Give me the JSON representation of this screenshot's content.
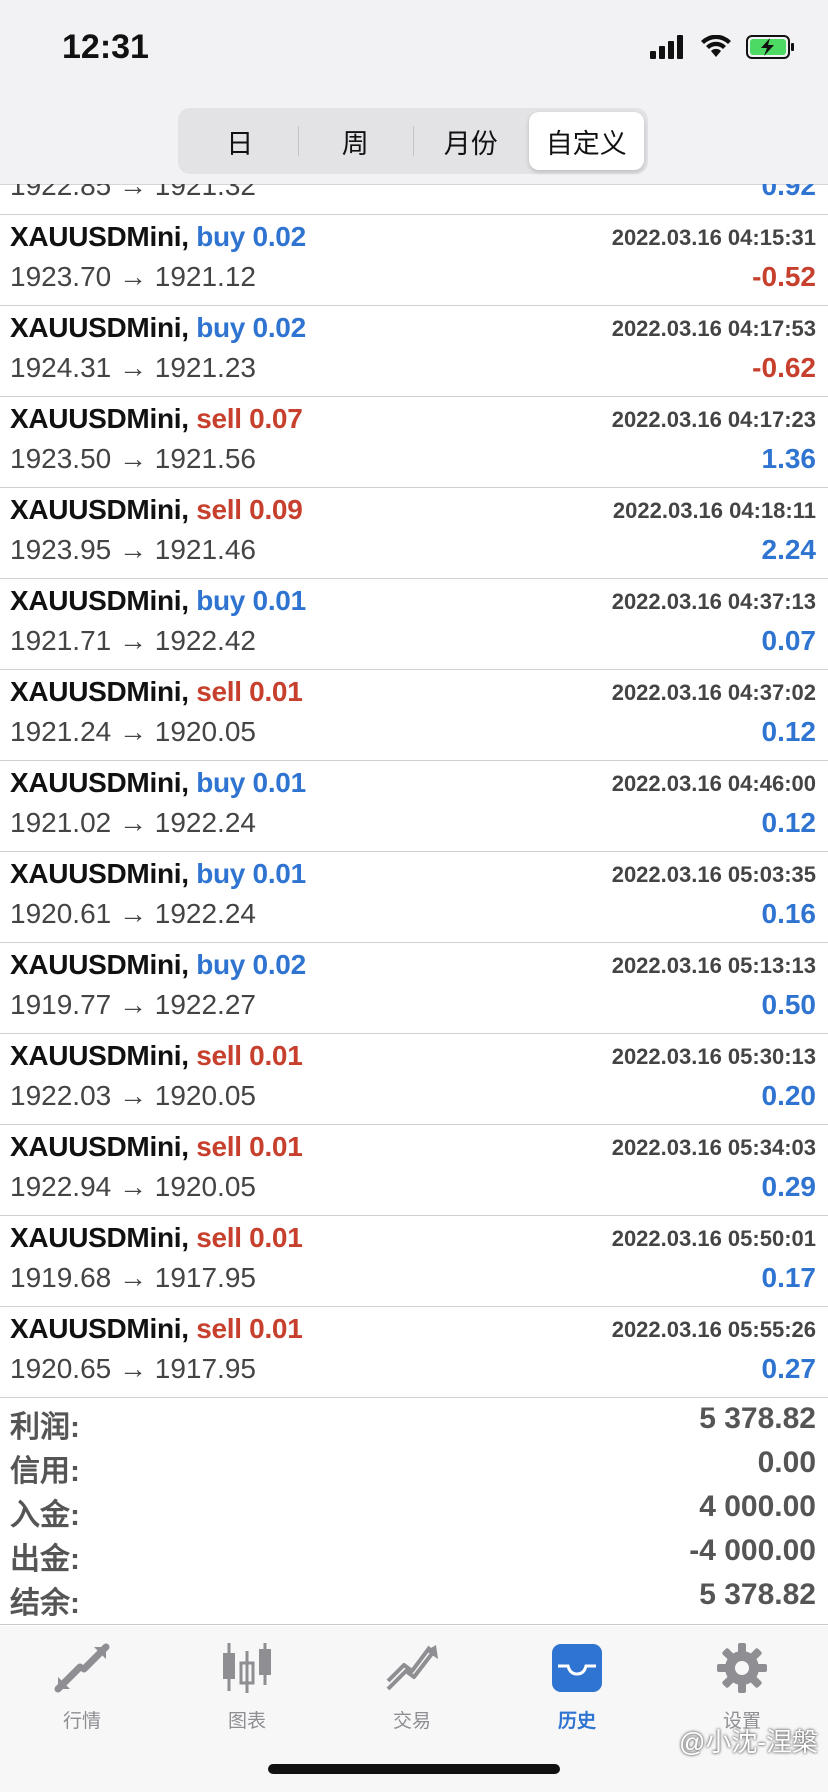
{
  "status_bar": {
    "time": "12:31"
  },
  "period_tabs": [
    {
      "label": "日",
      "active": false
    },
    {
      "label": "周",
      "active": false
    },
    {
      "label": "月份",
      "active": false
    },
    {
      "label": "自定义",
      "active": true
    }
  ],
  "partial_row": {
    "prices": "1922.85 → 1921.32",
    "profit": "0.92"
  },
  "deals": [
    {
      "symbol": "XAUUSDMini,",
      "direction": "buy 0.02",
      "type": "buy",
      "time": "2022.03.16 04:15:31",
      "prices": "1923.70 → 1921.12",
      "profit": "-0.52"
    },
    {
      "symbol": "XAUUSDMini,",
      "direction": "buy 0.02",
      "type": "buy",
      "time": "2022.03.16 04:17:53",
      "prices": "1924.31 → 1921.23",
      "profit": "-0.62"
    },
    {
      "symbol": "XAUUSDMini,",
      "direction": "sell 0.07",
      "type": "sell",
      "time": "2022.03.16 04:17:23",
      "prices": "1923.50 → 1921.56",
      "profit": "1.36"
    },
    {
      "symbol": "XAUUSDMini,",
      "direction": "sell 0.09",
      "type": "sell",
      "time": "2022.03.16 04:18:11",
      "prices": "1923.95 → 1921.46",
      "profit": "2.24"
    },
    {
      "symbol": "XAUUSDMini,",
      "direction": "buy 0.01",
      "type": "buy",
      "time": "2022.03.16 04:37:13",
      "prices": "1921.71 → 1922.42",
      "profit": "0.07"
    },
    {
      "symbol": "XAUUSDMini,",
      "direction": "sell 0.01",
      "type": "sell",
      "time": "2022.03.16 04:37:02",
      "prices": "1921.24 → 1920.05",
      "profit": "0.12"
    },
    {
      "symbol": "XAUUSDMini,",
      "direction": "buy 0.01",
      "type": "buy",
      "time": "2022.03.16 04:46:00",
      "prices": "1921.02 → 1922.24",
      "profit": "0.12"
    },
    {
      "symbol": "XAUUSDMini,",
      "direction": "buy 0.01",
      "type": "buy",
      "time": "2022.03.16 05:03:35",
      "prices": "1920.61 → 1922.24",
      "profit": "0.16"
    },
    {
      "symbol": "XAUUSDMini,",
      "direction": "buy 0.02",
      "type": "buy",
      "time": "2022.03.16 05:13:13",
      "prices": "1919.77 → 1922.27",
      "profit": "0.50"
    },
    {
      "symbol": "XAUUSDMini,",
      "direction": "sell 0.01",
      "type": "sell",
      "time": "2022.03.16 05:30:13",
      "prices": "1922.03 → 1920.05",
      "profit": "0.20"
    },
    {
      "symbol": "XAUUSDMini,",
      "direction": "sell 0.01",
      "type": "sell",
      "time": "2022.03.16 05:34:03",
      "prices": "1922.94 → 1920.05",
      "profit": "0.29"
    },
    {
      "symbol": "XAUUSDMini,",
      "direction": "sell 0.01",
      "type": "sell",
      "time": "2022.03.16 05:50:01",
      "prices": "1919.68 → 1917.95",
      "profit": "0.17"
    },
    {
      "symbol": "XAUUSDMini,",
      "direction": "sell 0.01",
      "type": "sell",
      "time": "2022.03.16 05:55:26",
      "prices": "1920.65 → 1917.95",
      "profit": "0.27"
    }
  ],
  "summary": [
    {
      "label": "利润:",
      "value": "5 378.82"
    },
    {
      "label": "信用:",
      "value": "0.00"
    },
    {
      "label": "入金:",
      "value": "4 000.00"
    },
    {
      "label": "出金:",
      "value": "-4 000.00"
    },
    {
      "label": "结余:",
      "value": "5 378.82"
    }
  ],
  "tabbar": [
    {
      "label": "行情",
      "icon": "quotes-icon",
      "active": false
    },
    {
      "label": "图表",
      "icon": "chart-icon",
      "active": false
    },
    {
      "label": "交易",
      "icon": "trade-icon",
      "active": false
    },
    {
      "label": "历史",
      "icon": "history-icon",
      "active": true
    },
    {
      "label": "设置",
      "icon": "settings-icon",
      "active": false
    }
  ],
  "watermark": "@小沈-涅槃",
  "colors": {
    "buy": "#2f74d0",
    "sell": "#c7402d",
    "active_tab": "#2f74d0",
    "inactive_tab": "#8e8e93"
  }
}
